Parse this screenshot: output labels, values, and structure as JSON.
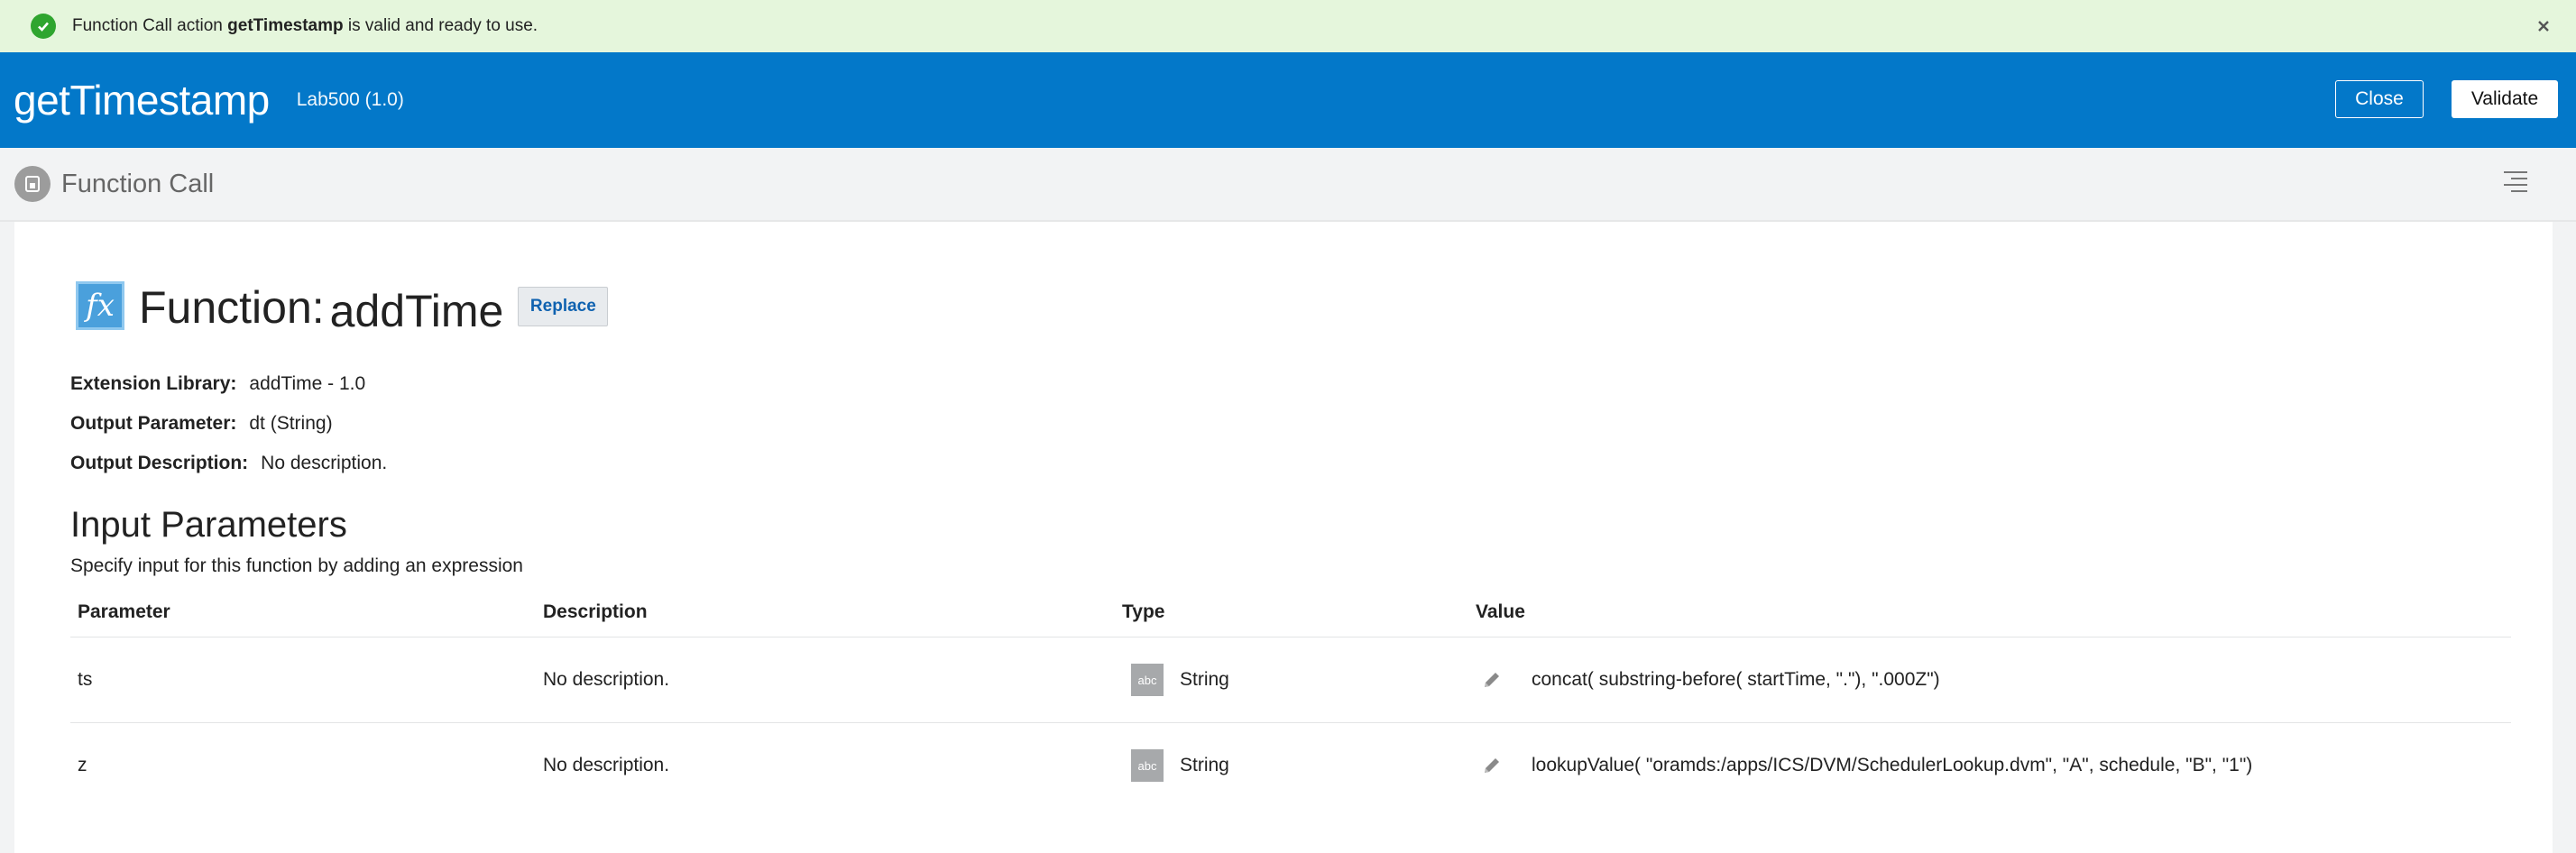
{
  "notification": {
    "prefix": "Function Call action",
    "name": "getTimestamp",
    "suffix": "is valid and ready to use."
  },
  "header": {
    "title": "getTimestamp",
    "version": "Lab500 (1.0)",
    "close_label": "Close",
    "validate_label": "Validate",
    "background": "#0378c9"
  },
  "subheader": {
    "label": "Function Call"
  },
  "function": {
    "label": "Function:",
    "name": "addTime",
    "replace_label": "Replace",
    "icon": "fx-icon"
  },
  "details": {
    "extension_library_label": "Extension Library:",
    "extension_library_value": "addTime - 1.0",
    "output_parameter_label": "Output Parameter:",
    "output_parameter_value": "dt (String)",
    "output_description_label": "Output Description:",
    "output_description_value": "No description."
  },
  "inputs": {
    "title": "Input Parameters",
    "subtitle": "Specify input for this function by adding an expression",
    "columns": [
      "Parameter",
      "Description",
      "Type",
      "Value"
    ],
    "rows": [
      {
        "parameter": "ts",
        "description": "No description.",
        "type_icon": "abc",
        "type": "String",
        "value": "concat( substring-before( startTime, \".\"), \".000Z\")"
      },
      {
        "parameter": "z",
        "description": "No description.",
        "type_icon": "abc",
        "type": "String",
        "value": "lookupValue( \"oramds:/apps/ICS/DVM/SchedulerLookup.dvm\", \"A\", schedule, \"B\", \"1\")"
      }
    ]
  },
  "colors": {
    "success_bar": "#e5f6dc",
    "success_icon": "#2fa52f",
    "link_blue": "#0f62b0"
  }
}
